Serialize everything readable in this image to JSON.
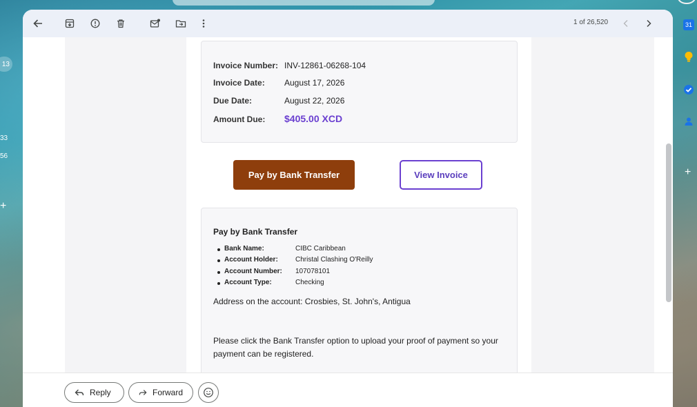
{
  "rail_left": {
    "badge": "13",
    "counts": [
      "33",
      "56"
    ],
    "plus": "+"
  },
  "toolbar": {
    "pager": "1 of 26,520"
  },
  "invoice": {
    "number_label": "Invoice Number:",
    "number_value": "INV-12861-06268-104",
    "date_label": "Invoice Date:",
    "date_value": "August 17, 2026",
    "due_label": "Due Date:",
    "due_value": "August 22, 2026",
    "amount_label": "Amount Due:",
    "amount_value": "$405.00 XCD"
  },
  "actions": {
    "pay_label": "Pay by Bank Transfer",
    "view_label": "View Invoice"
  },
  "bank": {
    "title": "Pay by Bank Transfer",
    "items": [
      {
        "key": "Bank Name:",
        "value": "CIBC Caribbean"
      },
      {
        "key": "Account Holder:",
        "value": "Christal Clashing O'Reilly"
      },
      {
        "key": "Account Number:",
        "value": "107078101"
      },
      {
        "key": "Account Type:",
        "value": "Checking"
      }
    ],
    "address": "Address on the account: Crosbies, St. John's, Antigua",
    "note": "Please click the Bank Transfer option to upload your proof of payment so your payment can be registered."
  },
  "footer": {
    "reply_label": "Reply",
    "forward_label": "Forward"
  },
  "rail_right": {
    "calendar_day": "31",
    "plus": "+"
  },
  "colors": {
    "pay_button": "#8e3e0c",
    "accent_purple": "#6a3fd0"
  }
}
